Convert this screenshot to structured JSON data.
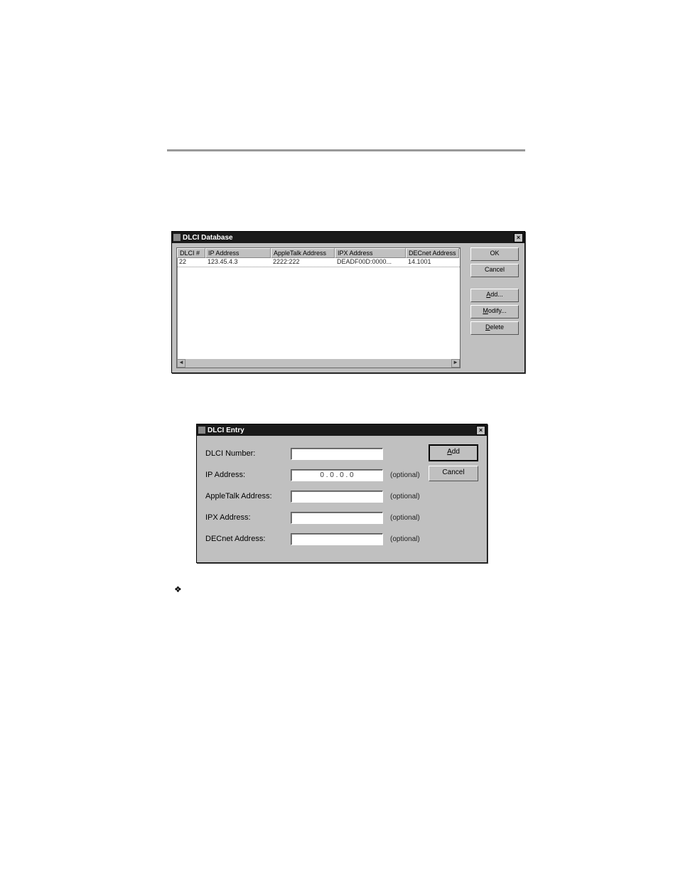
{
  "dlg1": {
    "title": "DLCI Database",
    "columns": {
      "dlci": "DLCI #",
      "ip": "IP Address",
      "atlk": "AppleTalk Address",
      "ipx": "IPX Address",
      "dec": "DECnet Address"
    },
    "row0": {
      "dlci": "22",
      "ip": "123.45.4.3",
      "atlk": "2222:222",
      "ipx": "DEADF00D:0000...",
      "dec": "14.1001"
    },
    "buttons": {
      "ok": "OK",
      "cancel": "Cancel",
      "add": "Add...",
      "modify": "Modify...",
      "delete": "Delete"
    },
    "scroll_left": "◄",
    "scroll_right": "►",
    "close_x": "×"
  },
  "dlg2": {
    "title": "DLCI Entry",
    "labels": {
      "dlci": "DLCI Number:",
      "ip": "IP Address:",
      "atlk": "AppleTalk Address:",
      "ipx": "IPX Address:",
      "dec": "DECnet Address:"
    },
    "values": {
      "dlci": "",
      "ip": "0   .   0   .   0   .   0",
      "atlk": "",
      "ipx": "",
      "dec": ""
    },
    "optional": "(optional)",
    "buttons": {
      "add": "Add",
      "cancel": "Cancel"
    },
    "close_x": "×"
  },
  "bullet": "❖"
}
